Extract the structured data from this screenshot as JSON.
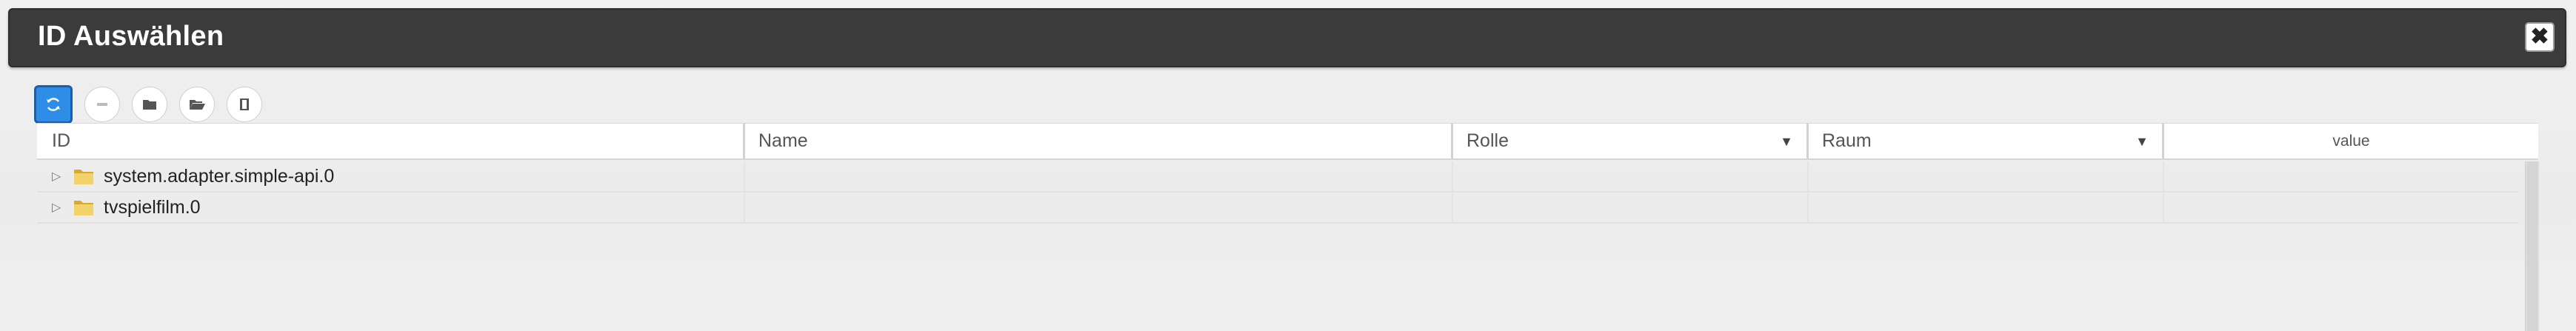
{
  "dialog": {
    "title": "ID Auswählen",
    "close_icon": "close-icon"
  },
  "toolbar": {
    "buttons": [
      {
        "name": "refresh",
        "icon": "refresh-icon",
        "active": true
      },
      {
        "name": "collapse-all",
        "icon": "minus-icon",
        "active": false
      },
      {
        "name": "folder",
        "icon": "folder-icon",
        "active": false
      },
      {
        "name": "folder-open",
        "icon": "folder-open-icon",
        "active": false
      },
      {
        "name": "book",
        "icon": "book-icon",
        "active": false
      }
    ]
  },
  "grid": {
    "columns": {
      "id": "ID",
      "name": "Name",
      "rolle": "Rolle",
      "raum": "Raum",
      "value": "value"
    },
    "filter_arrow": "▼",
    "rows": [
      {
        "id": "system.adapter.simple-api.0",
        "name": "",
        "rolle": "",
        "raum": "",
        "value": ""
      },
      {
        "id": "tvspielfilm.0",
        "name": "",
        "rolle": "",
        "raum": "",
        "value": ""
      }
    ]
  },
  "colors": {
    "titlebar": "#3b3b3b",
    "accent": "#2e8de6",
    "folder": "#e8c24a"
  }
}
